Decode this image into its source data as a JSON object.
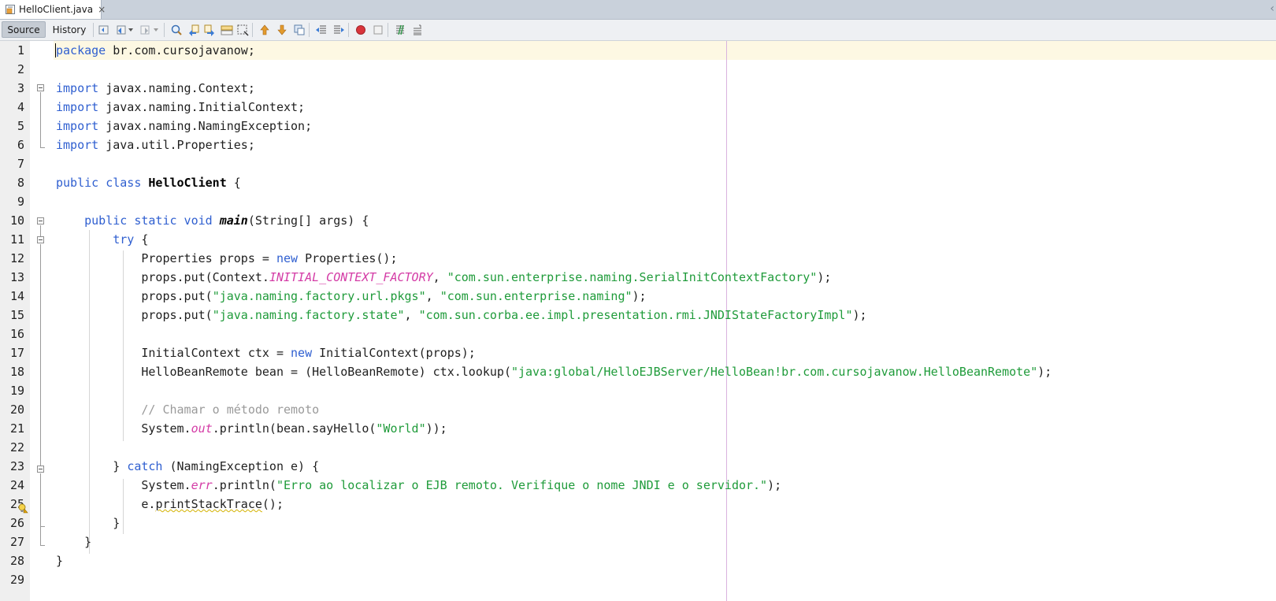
{
  "window": {
    "tab_label": "HelloClient.java",
    "tab_close": "×",
    "overflow_chevron": "‹"
  },
  "toolbar": {
    "source_label": "Source",
    "history_label": "History"
  },
  "editor": {
    "line_numbers": [
      "1",
      "2",
      "3",
      "4",
      "5",
      "6",
      "7",
      "8",
      "9",
      "10",
      "11",
      "12",
      "13",
      "14",
      "15",
      "16",
      "17",
      "18",
      "19",
      "20",
      "21",
      "22",
      "23",
      "24",
      "25",
      "26",
      "27",
      "28",
      "29"
    ],
    "lines": [
      [
        [
          "kw",
          "package"
        ],
        [
          "p",
          " br.com.cursojavanow;"
        ]
      ],
      [],
      [
        [
          "kw",
          "import"
        ],
        [
          "p",
          " javax.naming.Context;"
        ]
      ],
      [
        [
          "kw",
          "import"
        ],
        [
          "p",
          " javax.naming.InitialContext;"
        ]
      ],
      [
        [
          "kw",
          "import"
        ],
        [
          "p",
          " javax.naming.NamingException;"
        ]
      ],
      [
        [
          "kw",
          "import"
        ],
        [
          "p",
          " java.util.Properties;"
        ]
      ],
      [],
      [
        [
          "kw",
          "public class"
        ],
        [
          "p",
          " "
        ],
        [
          "cls",
          "HelloClient"
        ],
        [
          "p",
          " {"
        ]
      ],
      [],
      [
        [
          "p",
          "    "
        ],
        [
          "kw",
          "public static void"
        ],
        [
          "p",
          " "
        ],
        [
          "meth",
          "main"
        ],
        [
          "p",
          "(String[] args) {"
        ]
      ],
      [
        [
          "p",
          "        "
        ],
        [
          "kw",
          "try"
        ],
        [
          "p",
          " {"
        ]
      ],
      [
        [
          "p",
          "            Properties props = "
        ],
        [
          "kw",
          "new"
        ],
        [
          "p",
          " Properties();"
        ]
      ],
      [
        [
          "p",
          "            props.put(Context."
        ],
        [
          "fld",
          "INITIAL_CONTEXT_FACTORY"
        ],
        [
          "p",
          ", "
        ],
        [
          "str",
          "\"com.sun.enterprise.naming.SerialInitContextFactory\""
        ],
        [
          "p",
          ");"
        ]
      ],
      [
        [
          "p",
          "            props.put("
        ],
        [
          "str",
          "\"java.naming.factory.url.pkgs\""
        ],
        [
          "p",
          ", "
        ],
        [
          "str",
          "\"com.sun.enterprise.naming\""
        ],
        [
          "p",
          ");"
        ]
      ],
      [
        [
          "p",
          "            props.put("
        ],
        [
          "str",
          "\"java.naming.factory.state\""
        ],
        [
          "p",
          ", "
        ],
        [
          "str",
          "\"com.sun.corba.ee.impl.presentation.rmi.JNDIStateFactoryImpl\""
        ],
        [
          "p",
          ");"
        ]
      ],
      [],
      [
        [
          "p",
          "            InitialContext ctx = "
        ],
        [
          "kw",
          "new"
        ],
        [
          "p",
          " InitialContext(props);"
        ]
      ],
      [
        [
          "p",
          "            HelloBeanRemote bean = (HelloBeanRemote) ctx.lookup("
        ],
        [
          "str",
          "\"java:global/HelloEJBServer/HelloBean!br.com.cursojavanow.HelloBeanRemote\""
        ],
        [
          "p",
          ");"
        ]
      ],
      [],
      [
        [
          "p",
          "            "
        ],
        [
          "cmt",
          "// Chamar o método remoto"
        ]
      ],
      [
        [
          "p",
          "            System."
        ],
        [
          "fld",
          "out"
        ],
        [
          "p",
          ".println(bean.sayHello("
        ],
        [
          "str",
          "\"World\""
        ],
        [
          "p",
          "));"
        ]
      ],
      [],
      [
        [
          "p",
          "        } "
        ],
        [
          "kw",
          "catch"
        ],
        [
          "p",
          " (NamingException e) {"
        ]
      ],
      [
        [
          "p",
          "            System."
        ],
        [
          "fld",
          "err"
        ],
        [
          "p",
          ".println("
        ],
        [
          "str",
          "\"Erro ao localizar o EJB remoto. Verifique o nome JNDI e o servidor.\""
        ],
        [
          "p",
          ");"
        ]
      ],
      [
        [
          "p",
          "            e."
        ],
        [
          "squig",
          "printStackTrace"
        ],
        [
          "p",
          "();"
        ]
      ],
      [
        [
          "p",
          "        }"
        ]
      ],
      [
        [
          "p",
          "    }"
        ]
      ],
      [
        [
          "p",
          "}"
        ]
      ],
      []
    ]
  },
  "colors": {
    "keyword": "#2f5fd0",
    "string": "#1f9b3a",
    "static_field": "#d43ca6",
    "comment": "#9a9a9a",
    "current_line": "#fdf8e3",
    "right_margin": "#d9b3de"
  }
}
